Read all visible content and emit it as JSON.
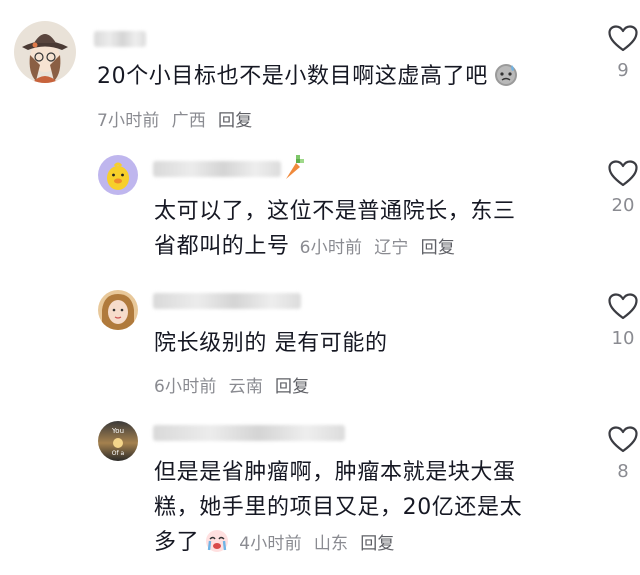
{
  "comments": [
    {
      "text": "20个小目标也不是小数目啊这虚高了吧",
      "time": "7小时前",
      "location": "广西",
      "reply": "回复",
      "likes": "9"
    },
    {
      "text_line1": "太可以了，这位不是普通院长，东三",
      "text_line2": "省都叫的上号",
      "time": "6小时前",
      "location": "辽宁",
      "reply": "回复",
      "likes": "20"
    },
    {
      "text": "院长级别的 是有可能的",
      "time": "6小时前",
      "location": "云南",
      "reply": "回复",
      "likes": "10"
    },
    {
      "text_line1": "但是是省肿瘤啊，肿瘤本就是块大蛋",
      "text_line2": "糕，她手里的项目又足，20亿还是太",
      "text_line3": "多了",
      "time": "4小时前",
      "location": "山东",
      "reply": "回复",
      "likes": "8",
      "avatar_text_top": "You",
      "avatar_text_bottom": "Of a"
    }
  ],
  "icons": {
    "like": "heart-outline-icon",
    "emoji_1": "sweat-emoji-icon",
    "emoji_4": "crying-emoji-icon"
  }
}
